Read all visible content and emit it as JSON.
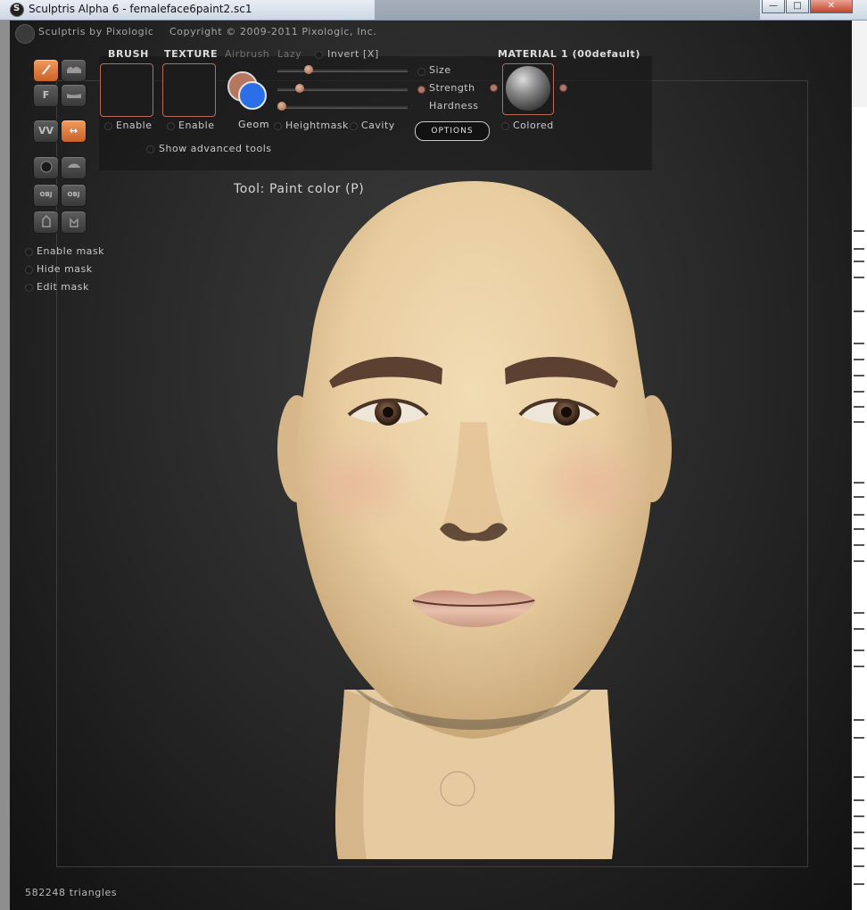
{
  "window": {
    "title": "Sculptris Alpha 6 - femaleface6paint2.sc1",
    "minimize": "—",
    "maximize": "□",
    "close": "✕"
  },
  "header": {
    "brand": "Sculptris by Pixologic",
    "copyright": "Copyright © 2009-2011 Pixologic, Inc."
  },
  "tools": {
    "buttons": [
      {
        "name": "paint-tool",
        "glyph": "/",
        "active": true
      },
      {
        "name": "paint-bump-tool",
        "glyph": "",
        "active": false
      },
      {
        "name": "flatten-paint-tool",
        "glyph": "F",
        "active": false
      },
      {
        "name": "smooth-paint-tool",
        "glyph": "",
        "active": false
      },
      {
        "name": "symmetry-toggle",
        "glyph": "VV",
        "active": false
      },
      {
        "name": "mirror-toggle",
        "glyph": "↔",
        "active": true
      },
      {
        "name": "sphere-tool",
        "glyph": "",
        "active": false
      },
      {
        "name": "plane-tool",
        "glyph": "",
        "active": false
      },
      {
        "name": "import-obj-button",
        "glyph": "OBJ",
        "active": false
      },
      {
        "name": "export-obj-button",
        "glyph": "OBJ",
        "active": false
      },
      {
        "name": "save-button",
        "glyph": "",
        "active": false
      },
      {
        "name": "open-button",
        "glyph": "",
        "active": false
      }
    ],
    "mask": {
      "enable": "Enable mask",
      "hide": "Hide mask",
      "edit": "Edit mask"
    }
  },
  "brush": {
    "heading": "BRUSH",
    "enable": "Enable"
  },
  "texture": {
    "heading": "TEXTURE",
    "enable": "Enable"
  },
  "options": {
    "airbrush": "Airbrush",
    "lazy": "Lazy",
    "invert": "Invert [X]",
    "geom": "Geom",
    "heightmask": "Heightmask",
    "cavity": "Cavity",
    "show_advanced": "Show advanced tools",
    "options_button": "OPTIONS"
  },
  "sliders": [
    {
      "label": "Size",
      "value": 0.22
    },
    {
      "label": "Strength",
      "value": 0.15
    },
    {
      "label": "Hardness",
      "value": 0.0
    }
  ],
  "colors": {
    "primary": "#b5775f",
    "secondary": "#2a6ee8",
    "accent": "#e8773c"
  },
  "material": {
    "heading": "MATERIAL 1 (00default)",
    "colored": "Colored"
  },
  "status": {
    "tool": "Tool: Paint color (P)",
    "triangles": "582248 triangles"
  }
}
